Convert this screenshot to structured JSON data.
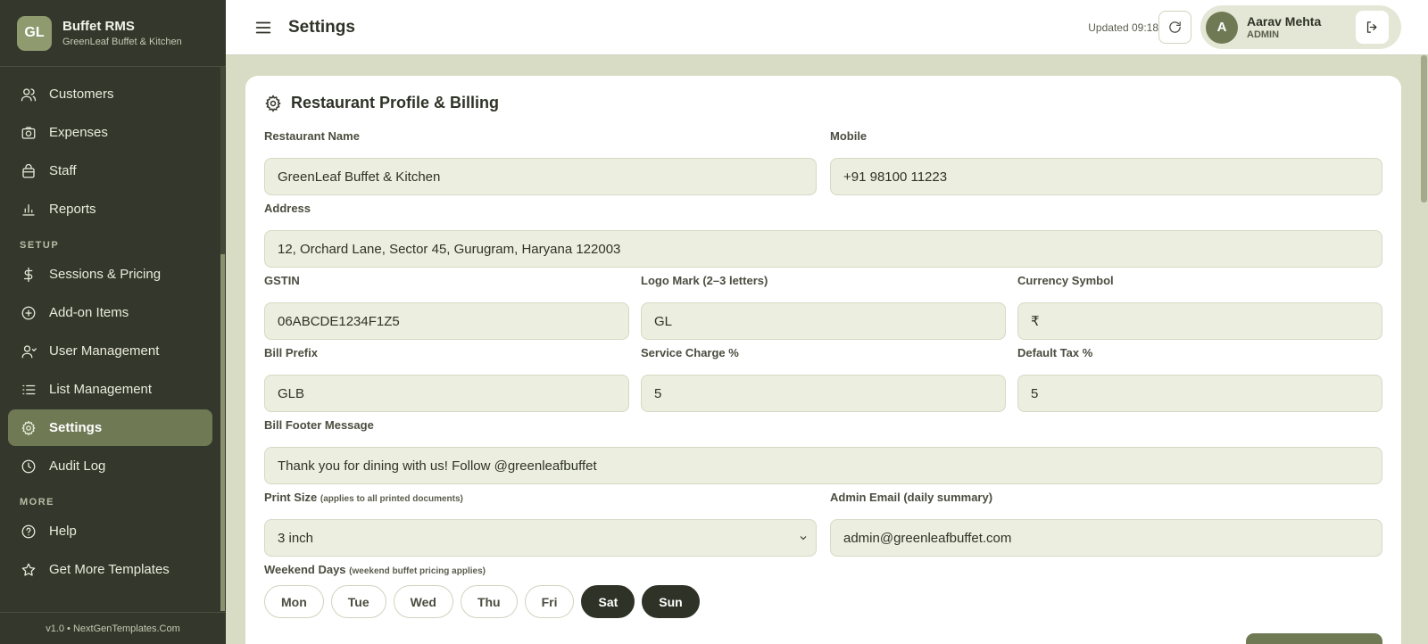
{
  "brand": {
    "logo": "GL",
    "name": "Buffet RMS",
    "subtitle": "GreenLeaf Buffet & Kitchen"
  },
  "sidebar": {
    "items_top": [
      {
        "label": "Customers",
        "icon": "users-icon"
      },
      {
        "label": "Expenses",
        "icon": "camera-icon"
      },
      {
        "label": "Staff",
        "icon": "bag-icon"
      },
      {
        "label": "Reports",
        "icon": "bar-chart-icon"
      }
    ],
    "section_setup": "SETUP",
    "items_setup": [
      {
        "label": "Sessions & Pricing",
        "icon": "dollar-icon"
      },
      {
        "label": "Add-on Items",
        "icon": "plus-circle-icon"
      },
      {
        "label": "User Management",
        "icon": "user-icon"
      },
      {
        "label": "List Management",
        "icon": "list-icon"
      },
      {
        "label": "Settings",
        "icon": "gear-icon",
        "active": true
      },
      {
        "label": "Audit Log",
        "icon": "clock-icon"
      }
    ],
    "section_more": "MORE",
    "items_more": [
      {
        "label": "Help",
        "icon": "help-icon"
      },
      {
        "label": "Get More Templates",
        "icon": "star-icon"
      }
    ],
    "footer": "v1.0 • NextGenTemplates.Com"
  },
  "topbar": {
    "title": "Settings",
    "updated": "Updated 09:18",
    "user": {
      "initial": "A",
      "name": "Aarav Mehta",
      "role": "ADMIN"
    }
  },
  "card": {
    "title": "Restaurant Profile & Billing",
    "fields": {
      "restaurant_name": {
        "label": "Restaurant Name",
        "value": "GreenLeaf Buffet & Kitchen"
      },
      "mobile": {
        "label": "Mobile",
        "value": "+91 98100 11223"
      },
      "address": {
        "label": "Address",
        "value": "12, Orchard Lane, Sector 45, Gurugram, Haryana 122003"
      },
      "gstin": {
        "label": "GSTIN",
        "value": "06ABCDE1234F1Z5"
      },
      "logo_mark": {
        "label": "Logo Mark (2–3 letters)",
        "value": "GL"
      },
      "currency": {
        "label": "Currency Symbol",
        "value": "₹"
      },
      "bill_prefix": {
        "label": "Bill Prefix",
        "value": "GLB"
      },
      "service_charge": {
        "label": "Service Charge %",
        "value": "5"
      },
      "default_tax": {
        "label": "Default Tax %",
        "value": "5"
      },
      "bill_footer": {
        "label": "Bill Footer Message",
        "value": "Thank you for dining with us! Follow @greenleafbuffet"
      },
      "print_size": {
        "label": "Print Size",
        "hint": "(applies to all printed documents)",
        "value": "3 inch"
      },
      "admin_email": {
        "label": "Admin Email (daily summary)",
        "value": "admin@greenleafbuffet.com"
      }
    },
    "weekend": {
      "label": "Weekend Days",
      "hint": "(weekend buffet pricing applies)",
      "days": [
        {
          "label": "Mon",
          "on": false
        },
        {
          "label": "Tue",
          "on": false
        },
        {
          "label": "Wed",
          "on": false
        },
        {
          "label": "Thu",
          "on": false
        },
        {
          "label": "Fri",
          "on": false
        },
        {
          "label": "Sat",
          "on": true
        },
        {
          "label": "Sun",
          "on": true
        }
      ]
    }
  },
  "colors": {
    "sidebar": "#34372b",
    "accent": "#6f7a55",
    "input_bg": "#eceedf",
    "page_bg": "#d8dcc4"
  }
}
